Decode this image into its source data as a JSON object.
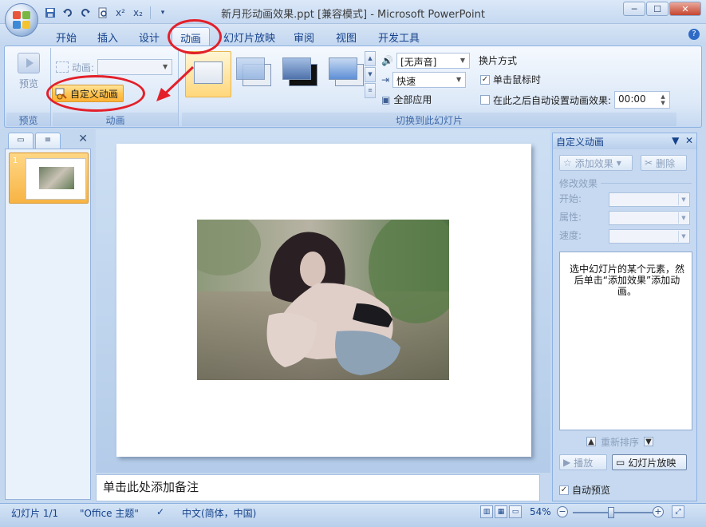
{
  "window": {
    "title": "新月形动画效果.ppt [兼容模式] - Microsoft PowerPoint",
    "min_label": "─",
    "max_label": "☐",
    "close_label": "✕"
  },
  "qat": {
    "save_icon": "save-icon",
    "undo_icon": "undo-icon",
    "redo_icon": "redo-icon",
    "print_preview_icon": "print-preview-icon",
    "superscript_label": "x²",
    "subscript_label": "x₂",
    "customize_icon": "chevron-down-icon"
  },
  "tabs": [
    "开始",
    "插入",
    "设计",
    "动画",
    "幻灯片放映",
    "审阅",
    "视图",
    "开发工具"
  ],
  "active_tab": "动画",
  "ribbon": {
    "preview_group": {
      "button_label": "预览",
      "group_label": "预览"
    },
    "animation_group": {
      "animation_label": "动画:",
      "animation_value": "",
      "custom_animation_label": "自定义动画",
      "group_label": "动画"
    },
    "transition_group": {
      "sound_value": "[无声音]",
      "speed_value": "快速",
      "apply_all_label": "全部应用",
      "switch_mode_label": "换片方式",
      "on_click_label": "单击鼠标时",
      "on_click_checked": true,
      "auto_after_label": "在此之后自动设置动画效果:",
      "auto_after_checked": false,
      "auto_after_value": "00:00",
      "group_label": "切换到此幻灯片"
    }
  },
  "left_panel": {
    "tab_slides_icon": "slide-tab-icon",
    "tab_outline_icon": "outline-tab-icon",
    "close_label": "✕",
    "slide_number": "1"
  },
  "notes": {
    "placeholder": "单击此处添加备注"
  },
  "task_pane": {
    "title": "自定义动画",
    "add_effect_label": "添加效果",
    "delete_label": "删除",
    "modify_label": "修改效果",
    "start_label": "开始:",
    "property_label": "属性:",
    "speed_label": "速度:",
    "hint_text": "选中幻灯片的某个元素，然后单击“添加效果”添加动画。",
    "reorder_label": "重新排序",
    "play_label": "播放",
    "slideshow_label": "幻灯片放映",
    "autopreview_label": "自动预览"
  },
  "statusbar": {
    "slide_info": "幻灯片 1/1",
    "theme": "\"Office 主题\"",
    "language": "中文(简体，中国)",
    "zoom": "54%"
  },
  "colors": {
    "accent": "#15428b",
    "annotation_red": "#e3202a",
    "selection_orange": "#ffc550"
  }
}
